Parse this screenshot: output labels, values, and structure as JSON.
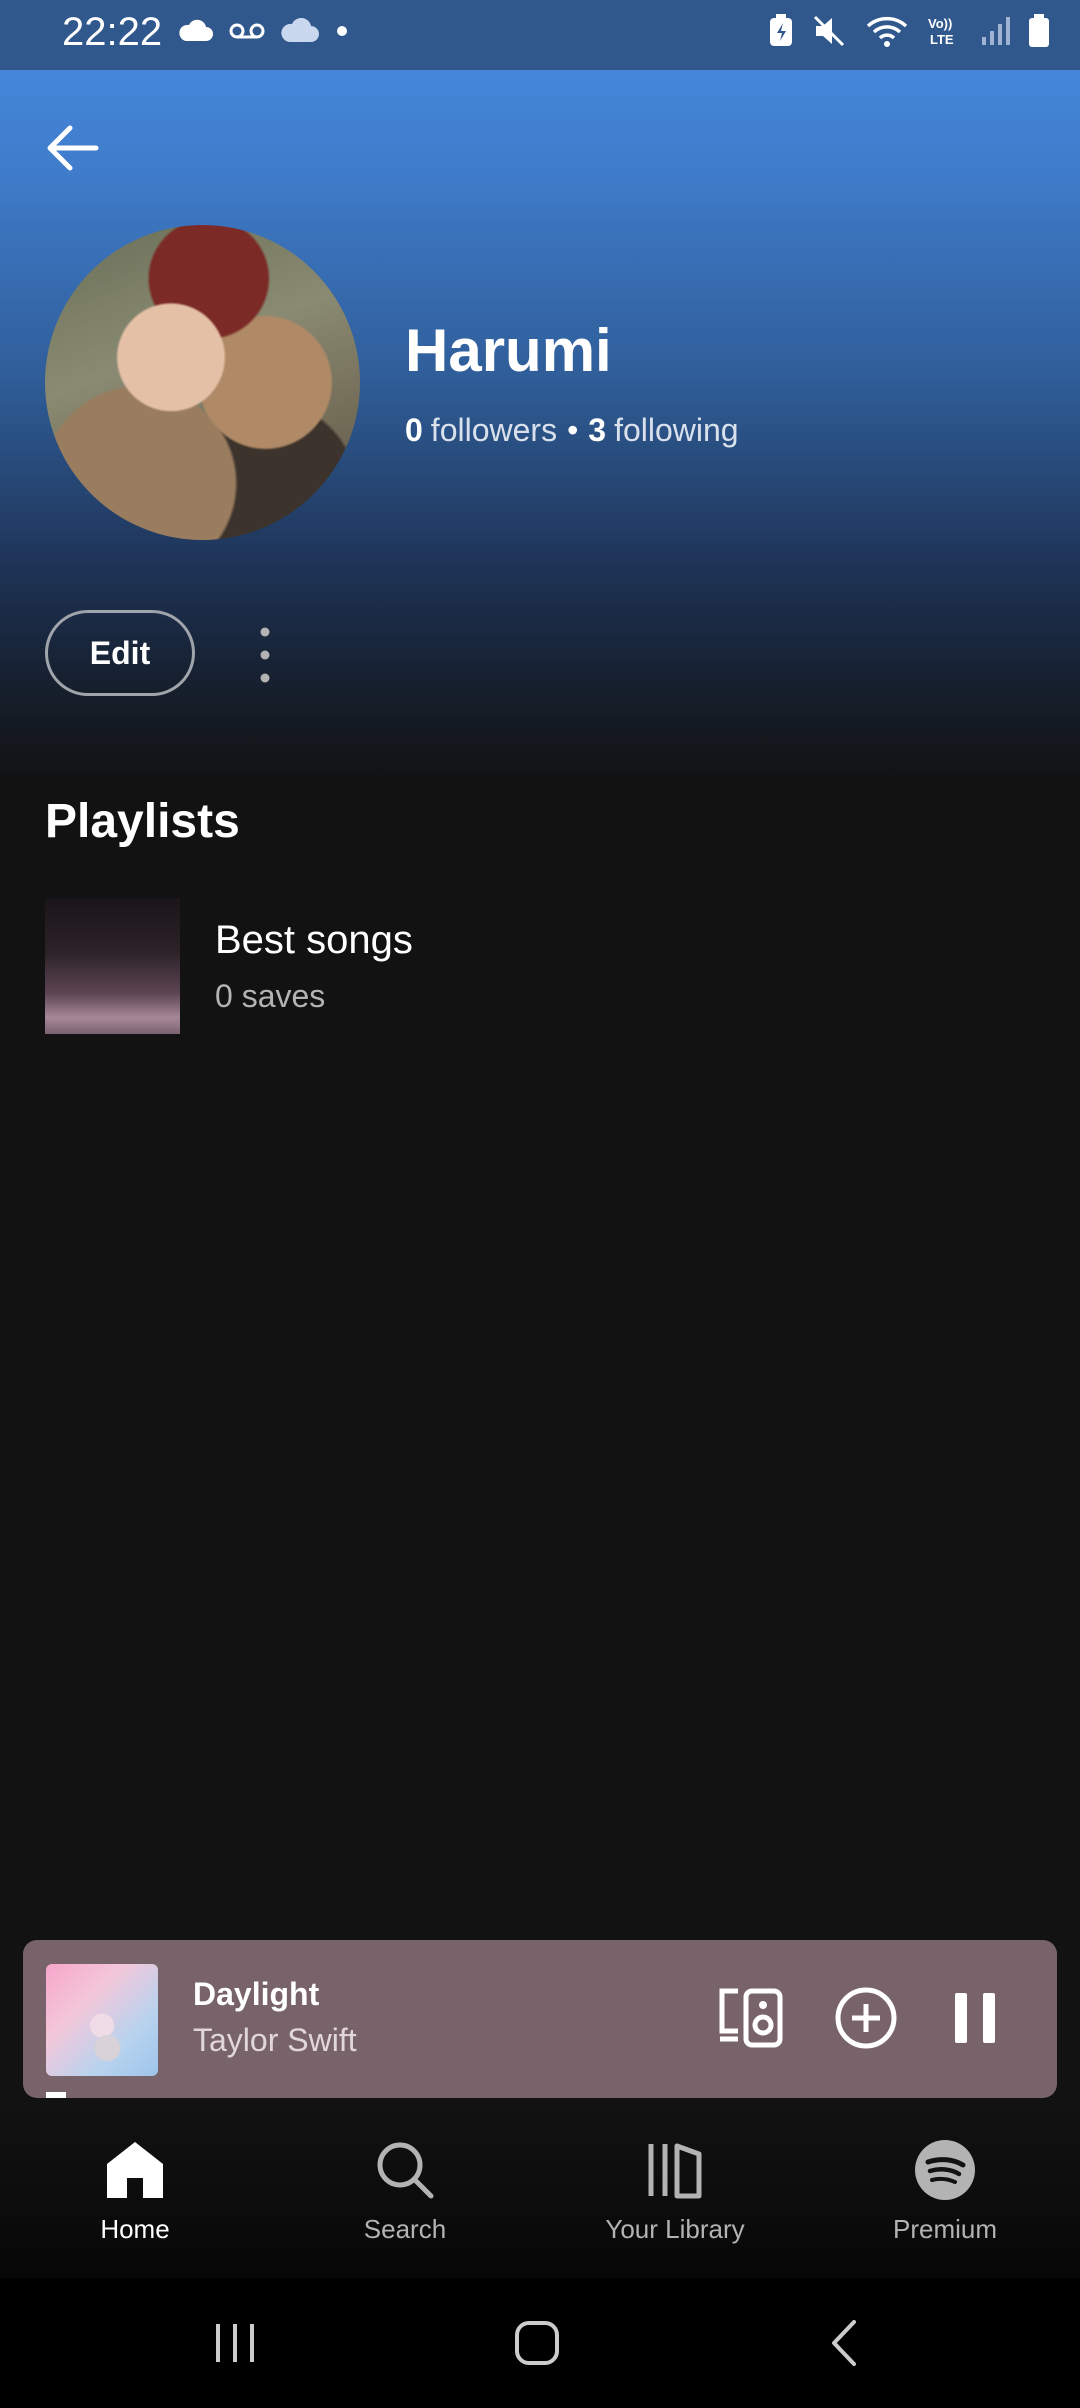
{
  "status_bar": {
    "time": "22:22",
    "icons": [
      "cloud-icon",
      "voicemail-icon",
      "cloud-icon",
      "dot-icon",
      "battery-saver-icon",
      "mute-icon",
      "wifi-icon",
      "volte-icon",
      "signal-icon",
      "battery-icon"
    ],
    "volte_label": "Vo)) LTE"
  },
  "profile": {
    "name": "Harumi",
    "followers_count": "0",
    "followers_label": "followers",
    "separator": "•",
    "following_count": "3",
    "following_label": "following",
    "edit_label": "Edit"
  },
  "playlists": {
    "title": "Playlists",
    "items": [
      {
        "title": "Best songs",
        "subtitle": "0 saves"
      }
    ]
  },
  "now_playing": {
    "title": "Daylight",
    "artist": "Taylor Swift",
    "progress": 0.02,
    "background": "#79636a"
  },
  "bottom_nav": {
    "items": [
      {
        "label": "Home",
        "icon": "home-icon",
        "active": true
      },
      {
        "label": "Search",
        "icon": "search-icon",
        "active": false
      },
      {
        "label": "Your Library",
        "icon": "library-icon",
        "active": false
      },
      {
        "label": "Premium",
        "icon": "spotify-icon",
        "active": false
      }
    ]
  },
  "colors": {
    "header_top": "#4a8ee3",
    "background": "#121212",
    "text_secondary": "#b3b3b3"
  }
}
